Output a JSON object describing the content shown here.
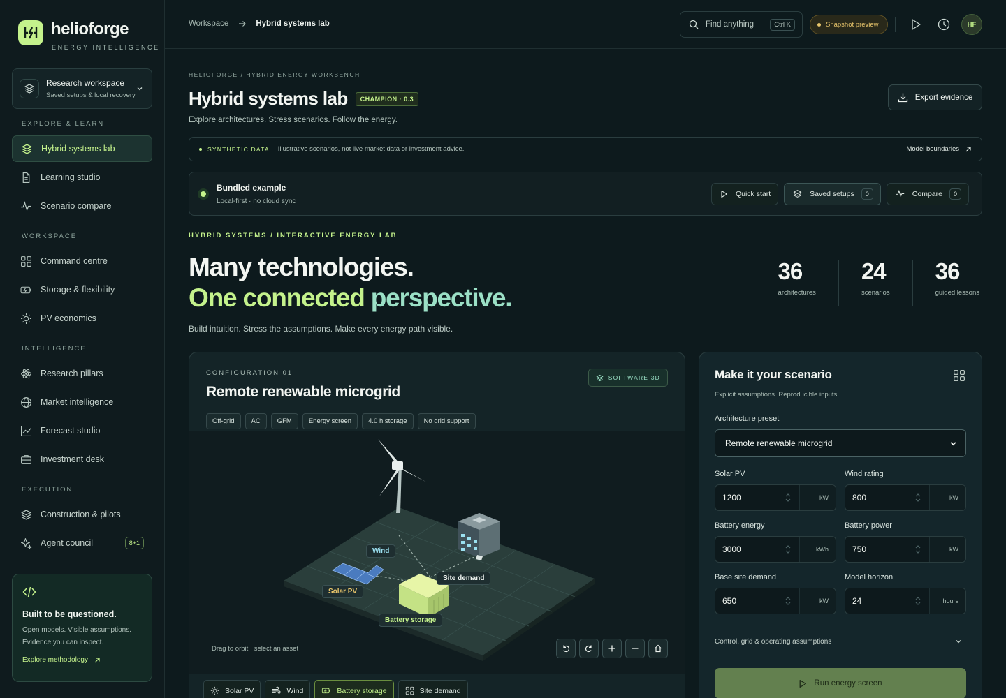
{
  "brand": {
    "name": "helioforge",
    "tagline": "ENERGY INTELLIGENCE"
  },
  "workspace_switcher": {
    "title": "Research workspace",
    "subtitle": "Saved setups & local recovery"
  },
  "nav": {
    "sections": [
      {
        "label": "EXPLORE & LEARN",
        "items": [
          {
            "label": "Hybrid systems lab",
            "icon": "layers-icon",
            "active": true
          },
          {
            "label": "Learning studio",
            "icon": "document-icon"
          },
          {
            "label": "Scenario compare",
            "icon": "pulse-icon"
          }
        ]
      },
      {
        "label": "WORKSPACE",
        "items": [
          {
            "label": "Command centre",
            "icon": "grid-icon"
          },
          {
            "label": "Storage & flexibility",
            "icon": "battery-icon"
          },
          {
            "label": "PV economics",
            "icon": "sun-icon"
          }
        ]
      },
      {
        "label": "INTELLIGENCE",
        "items": [
          {
            "label": "Research pillars",
            "icon": "atom-icon"
          },
          {
            "label": "Market intelligence",
            "icon": "globe-icon"
          },
          {
            "label": "Forecast studio",
            "icon": "chart-line-icon"
          },
          {
            "label": "Investment desk",
            "icon": "briefcase-icon"
          }
        ]
      },
      {
        "label": "EXECUTION",
        "items": [
          {
            "label": "Construction & pilots",
            "icon": "layers-icon"
          },
          {
            "label": "Agent council",
            "icon": "sparkle-icon",
            "badge": "8+1"
          }
        ]
      }
    ]
  },
  "methodology_card": {
    "title": "Built to be questioned.",
    "line1": "Open models. Visible assumptions.",
    "line2": "Evidence you can inspect.",
    "link": "Explore methodology"
  },
  "topbar": {
    "breadcrumb": [
      "Workspace",
      "Hybrid systems lab"
    ],
    "search_placeholder": "Find anything",
    "search_shortcut": "Ctrl K",
    "snapshot_label": "Snapshot preview",
    "avatar_initials": "HF"
  },
  "page": {
    "eyebrow": "HELIOFORGE / HYBRID ENERGY WORKBENCH",
    "title": "Hybrid systems lab",
    "badge": "CHAMPION · 0.3",
    "subtitle": "Explore architectures. Stress scenarios. Follow the energy.",
    "export_label": "Export evidence"
  },
  "notice": {
    "tag": "SYNTHETIC DATA",
    "message": "Illustrative scenarios, not live market data or investment advice.",
    "link": "Model boundaries"
  },
  "bundle": {
    "title": "Bundled example",
    "subtitle": "Local-first · no cloud sync",
    "quick_start": "Quick start",
    "saved_setups": "Saved setups",
    "saved_count": "0",
    "compare": "Compare",
    "compare_count": "0"
  },
  "hero": {
    "kicker": "HYBRID SYSTEMS / INTERACTIVE ENERGY LAB",
    "line1": "Many technologies.",
    "line2a": "One connected ",
    "line2b": "perspective.",
    "subtitle": "Build intuition. Stress the assumptions. Make every energy path visible.",
    "stats": [
      {
        "value": "36",
        "label": "architectures"
      },
      {
        "value": "24",
        "label": "scenarios"
      },
      {
        "value": "36",
        "label": "guided lessons"
      }
    ]
  },
  "config": {
    "eyebrow": "CONFIGURATION 01",
    "title": "Remote renewable microgrid",
    "mode_badge": "SOFTWARE 3D",
    "chips": [
      "Off-grid",
      "AC",
      "GFM",
      "Energy screen",
      "4.0 h storage",
      "No grid support"
    ],
    "scene_labels": {
      "wind": "Wind",
      "site_demand": "Site demand",
      "solar_pv": "Solar PV",
      "battery_storage": "Battery storage"
    },
    "hint": "Drag to orbit · select an asset",
    "asset_tabs": [
      {
        "label": "Solar PV",
        "icon": "sun-icon"
      },
      {
        "label": "Wind",
        "icon": "wind-icon"
      },
      {
        "label": "Battery storage",
        "icon": "battery-icon",
        "active": true
      },
      {
        "label": "Site demand",
        "icon": "grid-icon"
      }
    ]
  },
  "scenario": {
    "title": "Make it your scenario",
    "subtitle": "Explicit assumptions. Reproducible inputs.",
    "preset_label": "Architecture preset",
    "preset_value": "Remote renewable microgrid",
    "fields": [
      {
        "label": "Solar PV",
        "value": "1200",
        "unit": "kW"
      },
      {
        "label": "Wind rating",
        "value": "800",
        "unit": "kW"
      },
      {
        "label": "Battery energy",
        "value": "3000",
        "unit": "kWh"
      },
      {
        "label": "Battery power",
        "value": "750",
        "unit": "kW"
      },
      {
        "label": "Base site demand",
        "value": "650",
        "unit": "kW"
      },
      {
        "label": "Model horizon",
        "value": "24",
        "unit": "hours"
      }
    ],
    "accordion": "Control, grid & operating assumptions",
    "run_label": "Run energy screen"
  },
  "colors": {
    "accent": "#c4f28c",
    "teal": "#9be0c6",
    "amber": "#e8c56b",
    "bg": "#0d1a1d"
  }
}
